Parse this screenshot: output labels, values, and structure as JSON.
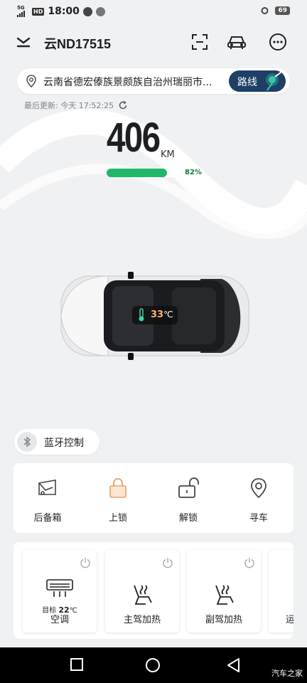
{
  "status_bar": {
    "network": "5G",
    "hd": "HD",
    "time": "18:00",
    "battery": "69"
  },
  "header": {
    "plate": "云ND17515"
  },
  "location": {
    "address": "云南省德宏傣族景颇族自治州瑞丽市...",
    "route_label": "路线"
  },
  "updated": {
    "label": "最后更新: 今天 17:52:25"
  },
  "range": {
    "value": "406",
    "unit": "KM",
    "battery_percent_label": "82%",
    "battery_fraction": 0.82
  },
  "cabin": {
    "temp_value": "33",
    "temp_unit": "℃"
  },
  "bluetooth": {
    "label": "蓝牙控制"
  },
  "actions": [
    {
      "label": "后备箱",
      "icon": "trunk-icon"
    },
    {
      "label": "上锁",
      "icon": "lock-icon"
    },
    {
      "label": "解锁",
      "icon": "unlock-icon"
    },
    {
      "label": "寻车",
      "icon": "locate-car-icon"
    }
  ],
  "climate": {
    "ac": {
      "label": "空调",
      "target_prefix": "目标",
      "target_value": "22",
      "target_unit": "℃"
    },
    "driver_heat": {
      "label": "主驾加热"
    },
    "passenger_heat": {
      "label": "副驾加热"
    },
    "partial_label": "运"
  },
  "watermark": "汽车之家",
  "colors": {
    "accent": "#1e3f66",
    "battery_green": "#1fb86a",
    "route_highlight": "#35c9a8"
  }
}
